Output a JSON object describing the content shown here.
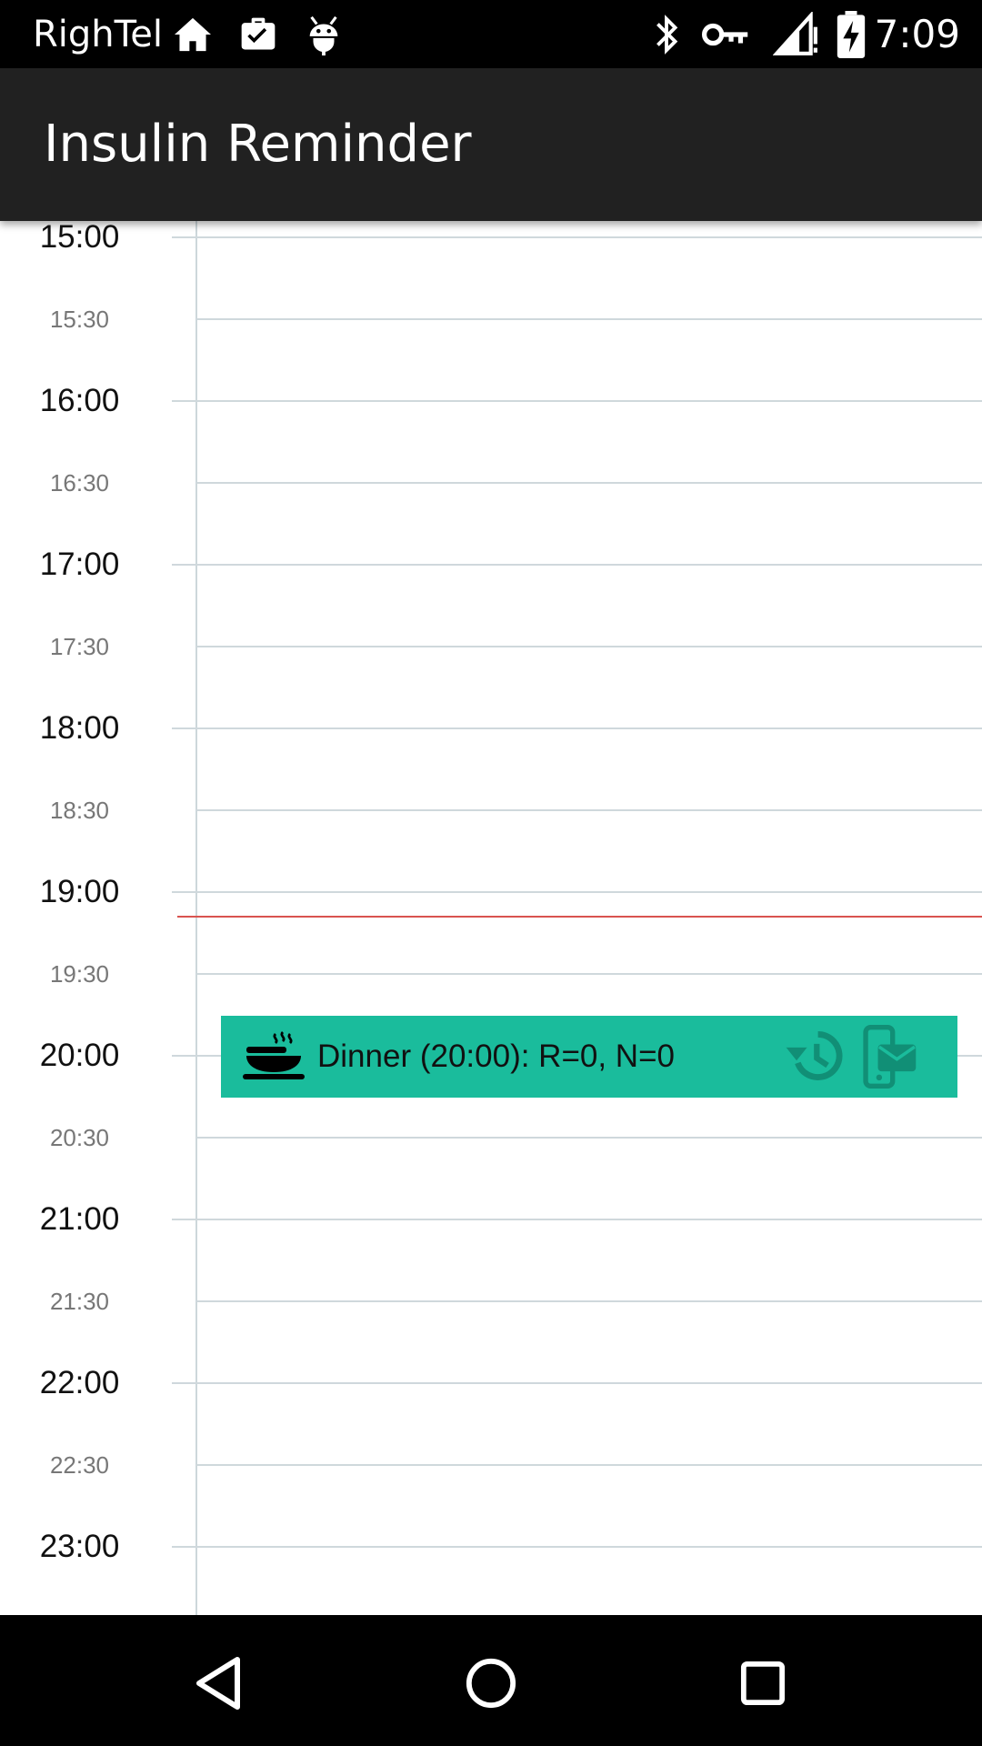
{
  "status_bar": {
    "carrier": "RighTel",
    "time": "7:09",
    "icons": [
      "home-icon",
      "briefcase-check-icon",
      "android-debug-icon",
      "bluetooth-icon",
      "vpn-key-icon",
      "signal-icon",
      "battery-charging-icon"
    ]
  },
  "app_bar": {
    "title": "Insulin Reminder"
  },
  "day_view": {
    "time_slots": [
      {
        "label": "15:00",
        "kind": "hour"
      },
      {
        "label": "15:30",
        "kind": "half"
      },
      {
        "label": "16:00",
        "kind": "hour"
      },
      {
        "label": "16:30",
        "kind": "half"
      },
      {
        "label": "17:00",
        "kind": "hour"
      },
      {
        "label": "17:30",
        "kind": "half"
      },
      {
        "label": "18:00",
        "kind": "hour"
      },
      {
        "label": "18:30",
        "kind": "half"
      },
      {
        "label": "19:00",
        "kind": "hour"
      },
      {
        "label": "19:30",
        "kind": "half"
      },
      {
        "label": "20:00",
        "kind": "hour"
      },
      {
        "label": "20:30",
        "kind": "half"
      },
      {
        "label": "21:00",
        "kind": "hour"
      },
      {
        "label": "21:30",
        "kind": "half"
      },
      {
        "label": "22:00",
        "kind": "hour"
      },
      {
        "label": "22:30",
        "kind": "half"
      },
      {
        "label": "23:00",
        "kind": "hour"
      }
    ],
    "current_time_color": "#d9534f",
    "events": [
      {
        "text": "Dinner (20:00): R=0, N=0",
        "icon": "meal-icon",
        "actions": [
          "history-icon",
          "sms-icon"
        ],
        "color": "#1abc9c"
      }
    ]
  },
  "nav_bar": {
    "buttons": [
      "back-icon",
      "home-circle-icon",
      "recents-icon"
    ]
  }
}
